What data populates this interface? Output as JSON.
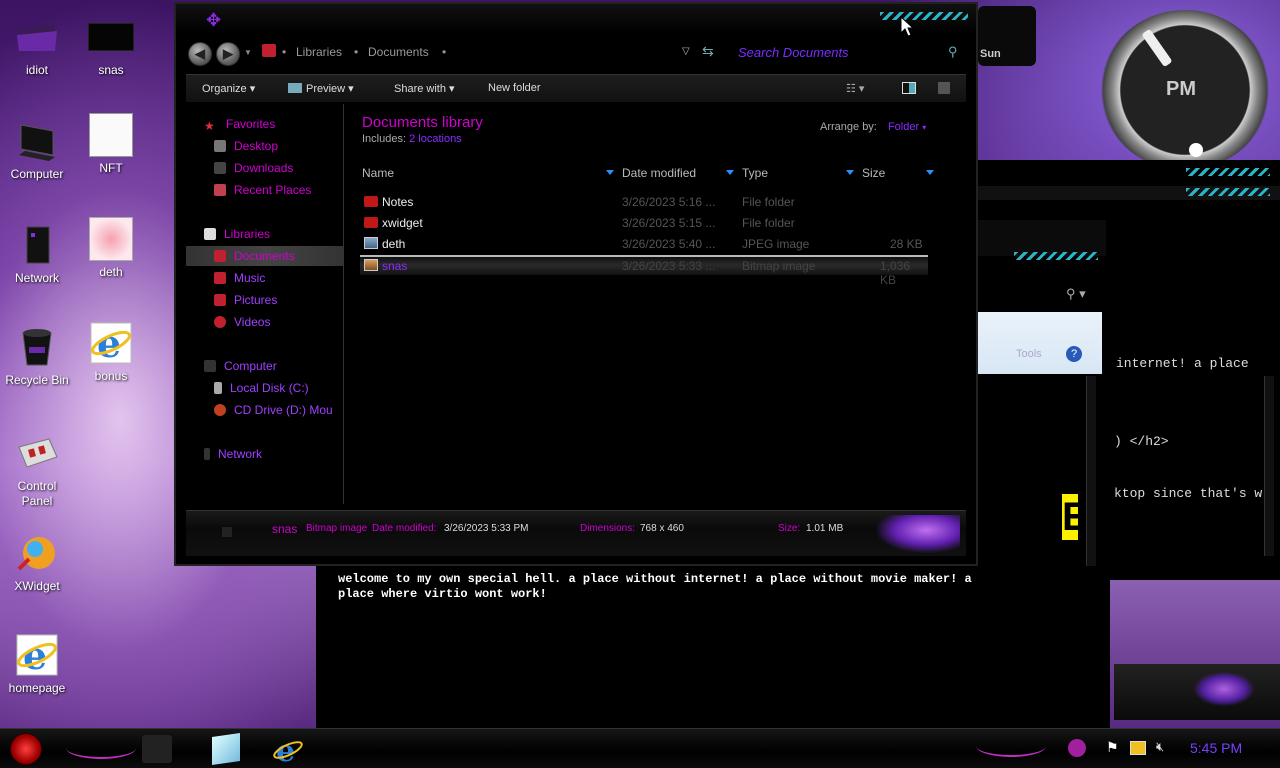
{
  "desktop": {
    "icons": [
      {
        "label": "idiot",
        "icon": "purple-folder-icon"
      },
      {
        "label": "snas",
        "icon": "image-thumbnail-icon"
      },
      {
        "label": "Computer",
        "icon": "computer-icon"
      },
      {
        "label": "NFT",
        "icon": "image-thumbnail-icon"
      },
      {
        "label": "Network",
        "icon": "network-icon"
      },
      {
        "label": "deth",
        "icon": "image-thumbnail-icon"
      },
      {
        "label": "Recycle Bin",
        "icon": "recycle-bin-icon"
      },
      {
        "label": "bonus",
        "icon": "internet-explorer-icon"
      },
      {
        "label": "Control\nPanel",
        "icon": "control-panel-icon"
      },
      {
        "label": "XWidget",
        "icon": "xwidget-icon"
      },
      {
        "label": "homepage",
        "icon": "internet-explorer-icon"
      }
    ]
  },
  "explorer": {
    "breadcrumb": [
      "Libraries",
      "Documents"
    ],
    "search_placeholder": "Search Documents",
    "toolbar": {
      "organize": "Organize",
      "preview": "Preview",
      "share_with": "Share with",
      "new_folder": "New folder"
    },
    "nav": {
      "favorites": "Favorites",
      "desktop": "Desktop",
      "downloads": "Downloads",
      "recent_places": "Recent Places",
      "libraries": "Libraries",
      "documents": "Documents",
      "music": "Music",
      "pictures": "Pictures",
      "videos": "Videos",
      "computer": "Computer",
      "local_disk": "Local Disk (C:)",
      "cd_drive": "CD Drive (D:) Mou",
      "network": "Network"
    },
    "library_title": "Documents library",
    "includes_label": "Includes:",
    "includes_link": "2 locations",
    "arrange_by_label": "Arrange by:",
    "arrange_by_value": "Folder",
    "columns": {
      "name": "Name",
      "date": "Date modified",
      "type": "Type",
      "size": "Size"
    },
    "files": [
      {
        "name": "Notes",
        "date": "3/26/2023 5:16 ...",
        "type": "File folder",
        "size": ""
      },
      {
        "name": "xwidget",
        "date": "3/26/2023 5:15 ...",
        "type": "File folder",
        "size": ""
      },
      {
        "name": "deth",
        "date": "3/26/2023 5:40 ...",
        "type": "JPEG image",
        "size": "28 KB"
      },
      {
        "name": "snas",
        "date": "3/26/2023 5:33 ...",
        "type": "Bitmap image",
        "size": "1,036 KB"
      }
    ],
    "details": {
      "name": "snas",
      "type": "Bitmap image",
      "date_label": "Date modified:",
      "date": "3/26/2023 5:33 PM",
      "dim_label": "Dimensions:",
      "dimensions": "768 x 460",
      "size_label": "Size:",
      "size": "1.01 MB"
    }
  },
  "editor_text": "welcome to my own special hell. a place without internet! a place without movie maker! a\nplace where virtio wont work!",
  "right_window": {
    "line1": "internet! a place",
    "line2": ") </h2>",
    "line3": "ktop since that's w",
    "tools": "Tools",
    "big_letter": "E"
  },
  "clock": {
    "ampm": "PM",
    "day": "Sun"
  },
  "taskbar": {
    "time": "5:45 PM"
  }
}
